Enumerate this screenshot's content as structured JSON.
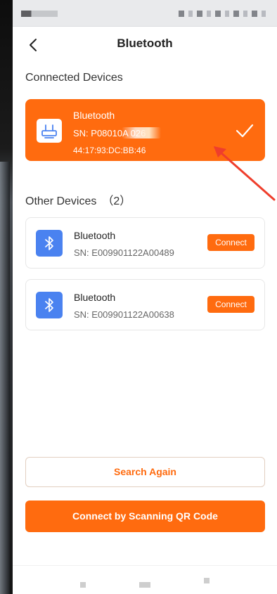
{
  "header": {
    "title": "Bluetooth"
  },
  "connected": {
    "section_title": "Connected Devices",
    "device": {
      "name": "Bluetooth",
      "sn": "SN: P08010A          026",
      "mac": "44:17:93:DC:BB:46"
    }
  },
  "other": {
    "section_title": "Other Devices",
    "count": "（2）",
    "devices": [
      {
        "name": "Bluetooth",
        "sn": "SN: E009901122A00489",
        "action": "Connect"
      },
      {
        "name": "Bluetooth",
        "sn": "SN: E009901122A00638",
        "action": "Connect"
      }
    ]
  },
  "actions": {
    "search_again": "Search Again",
    "scan_qr": "Connect by Scanning QR Code"
  },
  "icons": {
    "back": "chevron-left-icon",
    "router": "router-icon",
    "check": "check-icon",
    "bluetooth": "bluetooth-icon"
  },
  "colors": {
    "accent": "#ff6b0f",
    "bluetooth_tile": "#4a82f0",
    "annotation_arrow": "#ef3e2c"
  }
}
